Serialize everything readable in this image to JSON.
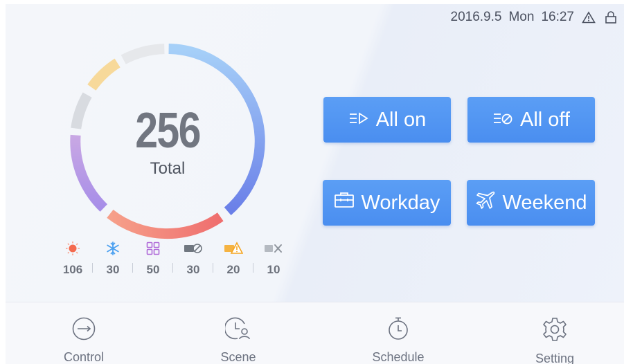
{
  "status": {
    "date": "2016.9.5",
    "weekday": "Mon",
    "time": "16:27",
    "icons": [
      "warning-icon",
      "lock-icon"
    ]
  },
  "summary": {
    "total_value": "256",
    "total_label": "Total"
  },
  "chart_data": {
    "type": "donut",
    "total": 256,
    "segments": [
      {
        "name": "blue",
        "color": "#6a8ef0"
      },
      {
        "name": "red",
        "color": "#f27c72"
      },
      {
        "name": "purple",
        "color": "#b79ee6"
      },
      {
        "name": "gray",
        "color": "#d9dce1"
      },
      {
        "name": "yellow",
        "color": "#f6d896"
      },
      {
        "name": "light-gray",
        "color": "#e6e8eb"
      }
    ]
  },
  "stats": [
    {
      "icon": "sun-icon",
      "value": "106",
      "color": "#f46a4e"
    },
    {
      "icon": "snowflake-icon",
      "value": "30",
      "color": "#4aa0f0"
    },
    {
      "icon": "grid-icon",
      "value": "50",
      "color": "#b06ad8"
    },
    {
      "icon": "device-off-icon",
      "value": "30",
      "color": "#707780"
    },
    {
      "icon": "device-warning-icon",
      "value": "20",
      "color": "#f5a623"
    },
    {
      "icon": "device-error-icon",
      "value": "10",
      "color": "#9aa0a8"
    }
  ],
  "buttons": {
    "all_on": "All on",
    "all_off": "All off",
    "workday": "Workday",
    "weekend": "Weekend"
  },
  "nav": [
    {
      "label": "Control",
      "icon": "control-icon"
    },
    {
      "label": "Scene",
      "icon": "scene-icon"
    },
    {
      "label": "Schedule",
      "icon": "timer-icon"
    },
    {
      "label": "Setting",
      "icon": "gear-icon"
    }
  ]
}
